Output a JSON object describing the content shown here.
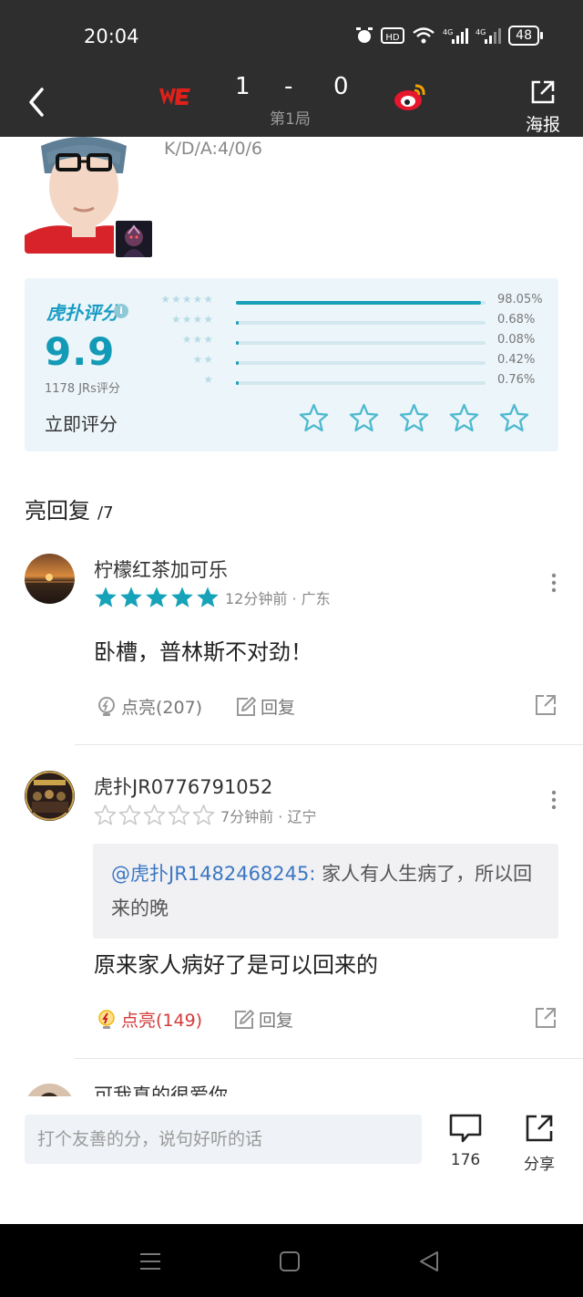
{
  "status_bar": {
    "time": "20:04",
    "network": "4G",
    "battery": "48"
  },
  "match": {
    "score_a": "1",
    "dash": "-",
    "score_b": "0",
    "game_no": "第1局",
    "poster_label": "海报"
  },
  "player": {
    "kda": "K/D/A:4/0/6"
  },
  "rating": {
    "brand": "虎扑评分",
    "brand_mark": "®",
    "info": "i",
    "score": "9.9",
    "count_label": "1178 JRs评分",
    "rate_now": "立即评分",
    "distribution": [
      {
        "stars": 5,
        "percent": 98.05,
        "label": "98.05%"
      },
      {
        "stars": 4,
        "percent": 0.68,
        "label": "0.68%"
      },
      {
        "stars": 3,
        "percent": 0.08,
        "label": "0.08%"
      },
      {
        "stars": 2,
        "percent": 0.42,
        "label": "0.42%"
      },
      {
        "stars": 1,
        "percent": 0.76,
        "label": "0.76%"
      }
    ],
    "accent": "#19a0b9"
  },
  "replies": {
    "title": "亮回复",
    "count": "/7",
    "items": [
      {
        "user": "柠檬红茶加可乐",
        "stars": 5,
        "time_loc": "12分钟前 · 广东",
        "body": "卧槽，普林斯不对劲！",
        "like_label": "点亮(207)",
        "reply_label": "回复"
      },
      {
        "user": "虎扑JR0776791052",
        "stars": 0,
        "time_loc": "7分钟前 · 辽宁",
        "quote_at": "@虎扑JR1482468245:",
        "quote_text": " 家人有人生病了，所以回来的晚",
        "body": "原来家人病好了是可以回来的",
        "like_label": "点亮(149)",
        "reply_label": "回复"
      },
      {
        "user": "可我真的很爱你"
      }
    ]
  },
  "bottom_bar": {
    "placeholder": "打个友善的分，说句好听的话",
    "comments_count": "176",
    "share_label": "分享"
  }
}
